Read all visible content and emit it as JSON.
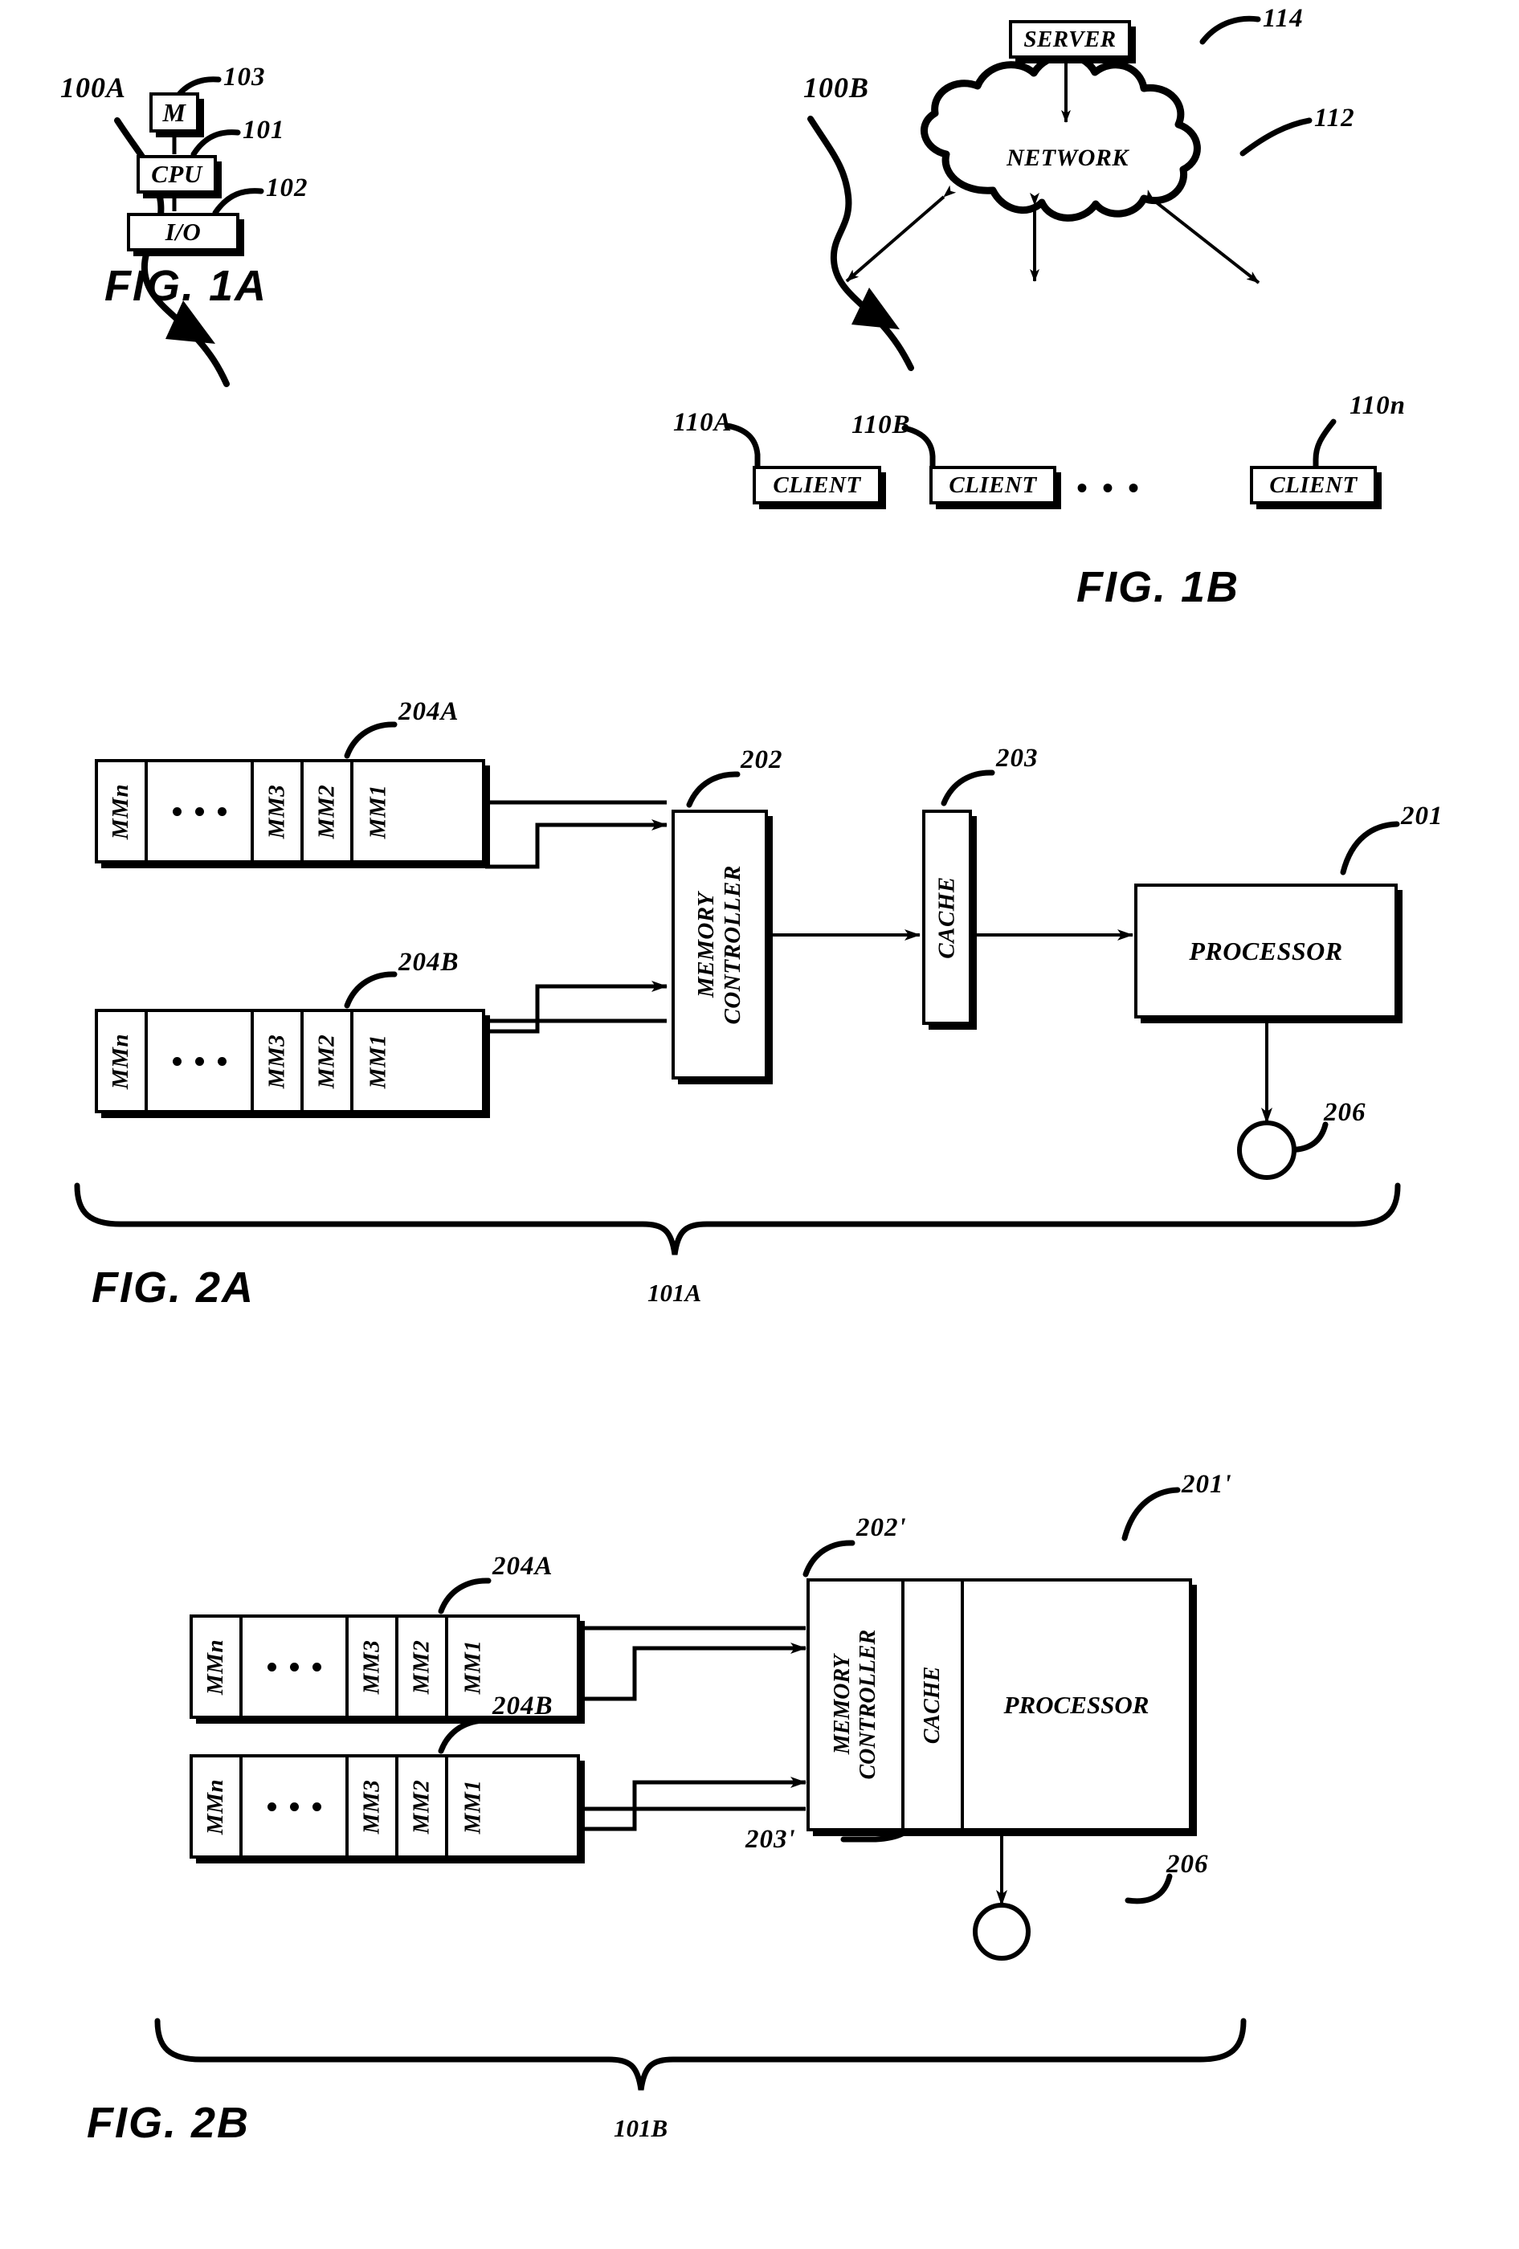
{
  "document": {
    "kind": "patent-drawing-sheet",
    "figures": [
      "FIG. 1A",
      "FIG. 1B",
      "FIG. 2A",
      "FIG. 2B"
    ]
  },
  "fig1a": {
    "caption": "FIG. 1A",
    "system_ref": "100A",
    "blocks": [
      {
        "label": "M",
        "ref": "103"
      },
      {
        "label": "CPU",
        "ref": "101"
      },
      {
        "label": "I/O",
        "ref": "102"
      }
    ]
  },
  "fig1b": {
    "caption": "FIG. 1B",
    "system_ref": "100B",
    "server": {
      "label": "SERVER",
      "ref": "114"
    },
    "network": {
      "label": "NETWORK",
      "ref": "112"
    },
    "clients": [
      {
        "label": "CLIENT",
        "ref": "110A"
      },
      {
        "label": "CLIENT",
        "ref": "110B"
      },
      {
        "label": "CLIENT",
        "ref": "110n"
      }
    ],
    "ellipsis": "• • •"
  },
  "fig2a": {
    "caption": "FIG. 2A",
    "assembly_ref": "101A",
    "banks": [
      {
        "ref": "204A",
        "cells": [
          "MMn",
          "",
          "MM3",
          "MM2",
          "MM1"
        ]
      },
      {
        "ref": "204B",
        "cells": [
          "MMn",
          "",
          "MM3",
          "MM2",
          "MM1"
        ]
      }
    ],
    "memory_controller": {
      "label_line1": "MEMORY",
      "label_line2": "CONTROLLER",
      "ref": "202"
    },
    "cache": {
      "label": "CACHE",
      "ref": "203"
    },
    "processor": {
      "label": "PROCESSOR",
      "ref": "201"
    },
    "node": {
      "ref": "206"
    }
  },
  "fig2b": {
    "caption": "FIG. 2B",
    "assembly_ref": "101B",
    "banks": [
      {
        "ref": "204A",
        "cells": [
          "MMn",
          "",
          "MM3",
          "MM2",
          "MM1"
        ]
      },
      {
        "ref": "204B",
        "cells": [
          "MMn",
          "",
          "MM3",
          "MM2",
          "MM1"
        ]
      }
    ],
    "memory_controller": {
      "label_line1": "MEMORY",
      "label_line2": "CONTROLLER",
      "ref": "202'"
    },
    "cache": {
      "label": "CACHE",
      "ref": "203'"
    },
    "processor": {
      "label": "PROCESSOR",
      "ref": "201'"
    },
    "node": {
      "ref": "206"
    }
  },
  "colors": {
    "ink": "#000000",
    "paper": "#ffffff"
  }
}
